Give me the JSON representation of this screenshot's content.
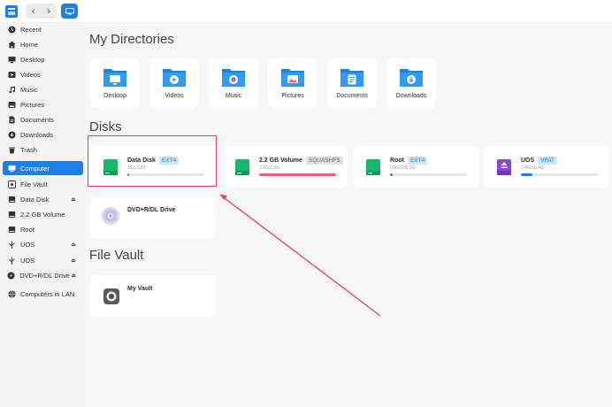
{
  "toolbar": {
    "back_glyph": "‹",
    "forward_glyph": "›"
  },
  "sidebar": {
    "items": [
      {
        "label": "Recent",
        "icon": "clock-icon"
      },
      {
        "label": "Home",
        "icon": "home-icon"
      },
      {
        "label": "Desktop",
        "icon": "desktop-icon"
      },
      {
        "label": "Videos",
        "icon": "video-icon"
      },
      {
        "label": "Music",
        "icon": "music-icon"
      },
      {
        "label": "Pictures",
        "icon": "picture-icon"
      },
      {
        "label": "Documents",
        "icon": "document-icon"
      },
      {
        "label": "Downloads",
        "icon": "download-icon"
      },
      {
        "label": "Trash",
        "icon": "trash-icon"
      },
      {
        "label": "Computer",
        "icon": "computer-icon"
      },
      {
        "label": "File Vault",
        "icon": "vault-icon"
      },
      {
        "label": "Data Disk",
        "icon": "disk-icon",
        "eject": "⏏"
      },
      {
        "label": "2.2 GB Volume",
        "icon": "disk-icon"
      },
      {
        "label": "Root",
        "icon": "disk-icon"
      },
      {
        "label": "UOS",
        "icon": "usb-icon",
        "eject": "⏏"
      },
      {
        "label": "UOS",
        "icon": "usb-icon",
        "eject": "⏏"
      },
      {
        "label": "DVD+R/DL Drive",
        "icon": "disc-icon",
        "eject": "⏏"
      },
      {
        "label": "Computers in LAN",
        "icon": "network-icon"
      }
    ],
    "active": "Computer"
  },
  "main": {
    "sections": {
      "directories": "My Directories",
      "disks": "Disks",
      "vault": "File Vault"
    },
    "directories": [
      {
        "name": "Desktop"
      },
      {
        "name": "Videos"
      },
      {
        "name": "Music"
      },
      {
        "name": "Pictures"
      },
      {
        "name": "Documents"
      },
      {
        "name": "Downloads"
      }
    ],
    "disks": [
      {
        "name": "Data Disk",
        "fs": "EXT4",
        "size": "16G/1.8T",
        "usage": 0.02,
        "bar_color": "#1e7fe6"
      },
      {
        "name": "2.2 GB Volume",
        "fs": "SQUASHFS",
        "size": "2.2G/2.2G",
        "usage": 1.0,
        "bar_color": "#ef6071"
      },
      {
        "name": "Root",
        "fs": "EXT4",
        "size": "6.8G/230.2G",
        "usage": 0.03,
        "bar_color": "#1e7fe6"
      },
      {
        "name": "UOS",
        "fs": "VFAT",
        "size": "2.4G/16.4G",
        "usage": 0.15,
        "bar_color": "#1e7fe6"
      },
      {
        "name": "DVD+R/DL Drive"
      }
    ],
    "vault": {
      "name": "My Vault"
    }
  },
  "colors": {
    "accent": "#1e7fe6",
    "highlight": "#e8415f",
    "disk_green": "#18b86b",
    "usb_purple": "#8b48d6"
  }
}
